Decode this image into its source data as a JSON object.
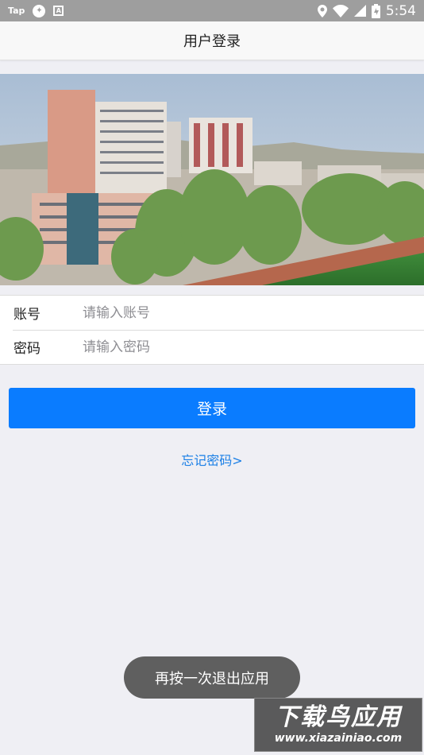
{
  "status_bar": {
    "left_text": "Tap",
    "time": "5:54"
  },
  "nav": {
    "title": "用户登录"
  },
  "form": {
    "account_label": "账号",
    "account_placeholder": "请输入账号",
    "password_label": "密码",
    "password_placeholder": "请输入密码"
  },
  "login_button": "登录",
  "forgot_link": "忘记密码>",
  "toast": "再按一次退出应用",
  "watermark": {
    "title": "下载鸟应用",
    "url": "www.xiazainiao.com"
  },
  "colors": {
    "accent": "#0a7cff",
    "link": "#1a7fe6",
    "background": "#efeff4"
  }
}
